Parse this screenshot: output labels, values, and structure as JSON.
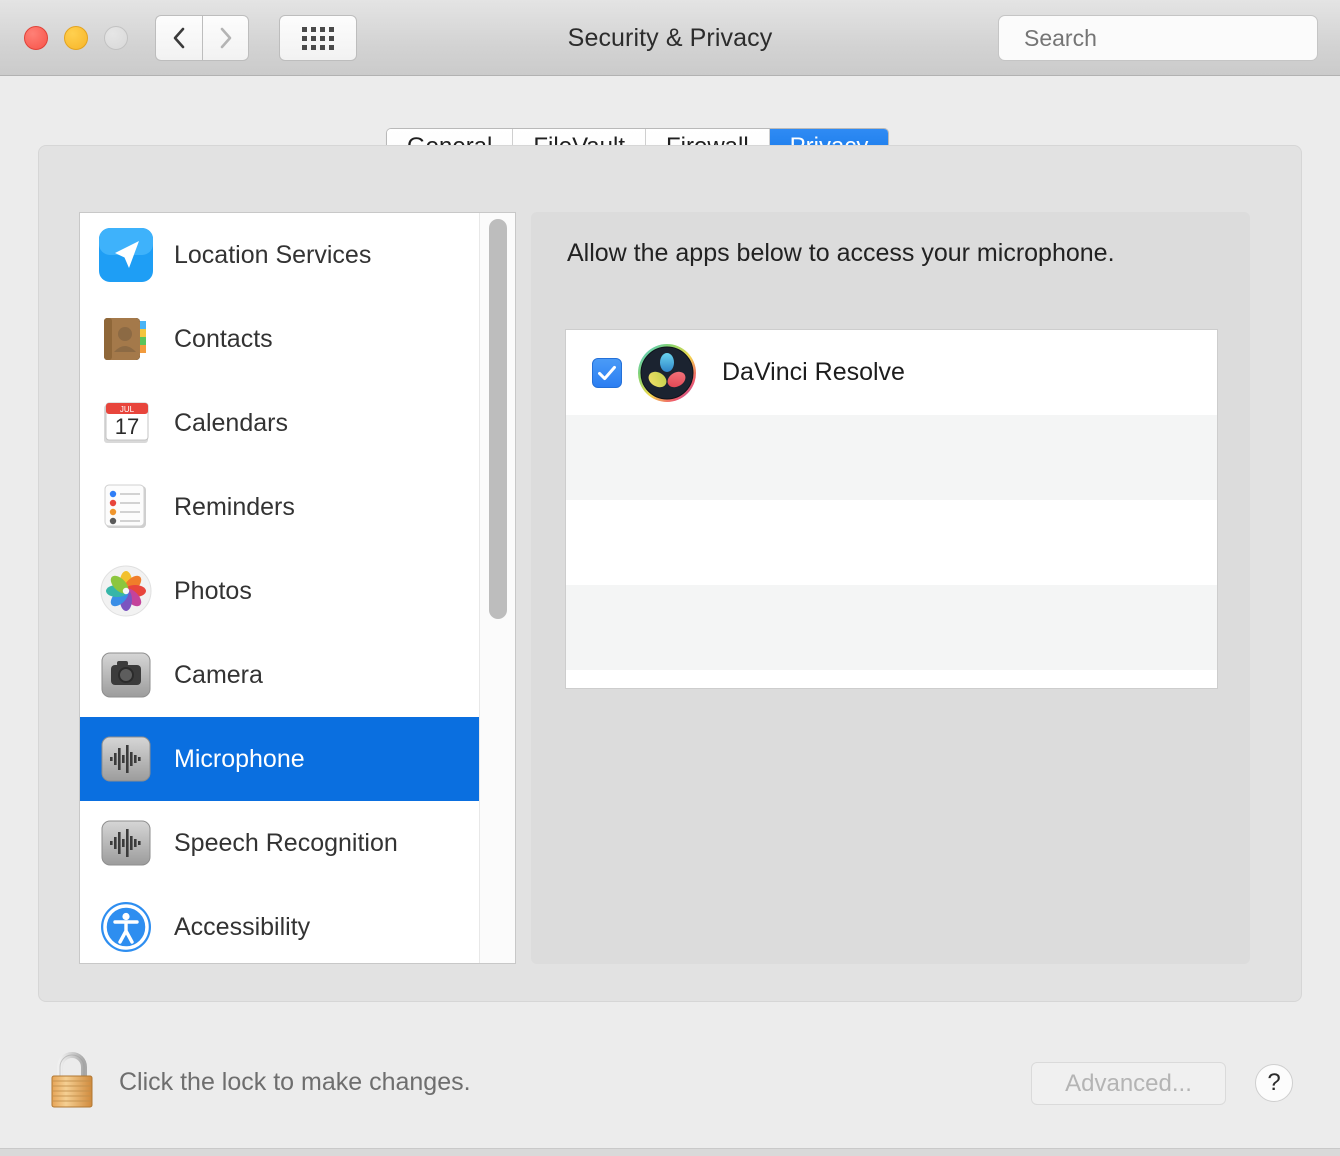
{
  "window": {
    "title": "Security & Privacy",
    "traffic_lights": [
      {
        "name": "close",
        "color": "#f75349",
        "enabled": true
      },
      {
        "name": "minimize",
        "color": "#f7b529",
        "enabled": true
      },
      {
        "name": "zoom",
        "color": "#d8d8d8",
        "enabled": false
      }
    ],
    "toolbar": {
      "back_label": "Back",
      "forward_label": "Forward",
      "grid_label": "Show All"
    },
    "search": {
      "placeholder": "Search",
      "value": "",
      "icon": "search-icon"
    }
  },
  "tabs": [
    {
      "label": "General",
      "selected": false
    },
    {
      "label": "FileVault",
      "selected": false
    },
    {
      "label": "Firewall",
      "selected": false
    },
    {
      "label": "Privacy",
      "selected": true
    }
  ],
  "sidebar": {
    "items": [
      {
        "label": "Location Services",
        "icon": "location-services-icon",
        "selected": false
      },
      {
        "label": "Contacts",
        "icon": "contacts-icon",
        "selected": false
      },
      {
        "label": "Calendars",
        "icon": "calendars-icon",
        "selected": false
      },
      {
        "label": "Reminders",
        "icon": "reminders-icon",
        "selected": false
      },
      {
        "label": "Photos",
        "icon": "photos-icon",
        "selected": false
      },
      {
        "label": "Camera",
        "icon": "camera-icon",
        "selected": false
      },
      {
        "label": "Microphone",
        "icon": "microphone-icon",
        "selected": true
      },
      {
        "label": "Speech Recognition",
        "icon": "speech-recognition-icon",
        "selected": false
      },
      {
        "label": "Accessibility",
        "icon": "accessibility-icon",
        "selected": false
      }
    ],
    "calendar_icon": {
      "month": "JUL",
      "day": "17"
    }
  },
  "detail": {
    "caption": "Allow the apps below to access your microphone.",
    "apps": [
      {
        "name": "DaVinci Resolve",
        "checked": true,
        "icon": "davinci-resolve-icon"
      }
    ],
    "empty_rows": 3
  },
  "footer": {
    "lock_icon": "lock-closed-icon",
    "lock_message": "Click the lock to make changes.",
    "advanced_label": "Advanced...",
    "advanced_enabled": false,
    "help_label": "?"
  },
  "colors": {
    "accent": "#0a6fe0",
    "tab_selected": "#1477e8",
    "checkbox": "#2b7ef2",
    "window_bg": "#ececec",
    "panel_bg": "#e2e2e2",
    "detail_bg": "#dcdcdc"
  }
}
